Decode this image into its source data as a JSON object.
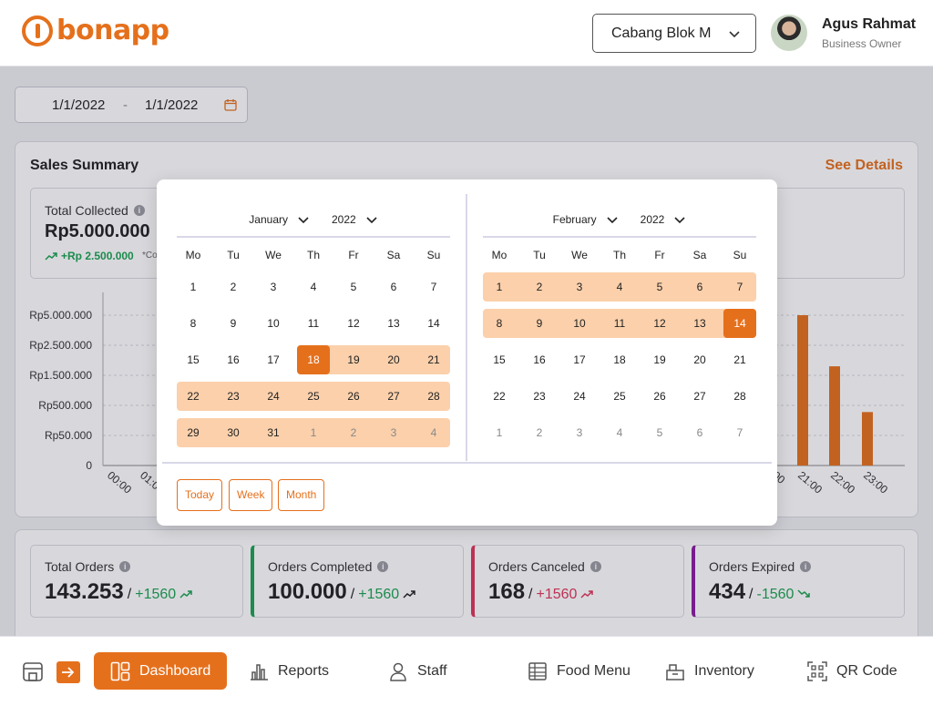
{
  "header": {
    "brand": "bonapp",
    "branch": "Cabang Blok M",
    "user_name": "Agus Rahmat",
    "user_role": "Business Owner"
  },
  "date_range": {
    "start": "1/1/2022",
    "separator": "-",
    "end": "1/1/2022"
  },
  "sales_summary": {
    "title": "Sales Summary",
    "see_details": "See Details",
    "collected_label": "Total Collected",
    "collected_value": "Rp5.000.000",
    "collected_delta": "+Rp 2.500.000",
    "collected_note": "*Co"
  },
  "chart_data": {
    "type": "bar",
    "ytick_labels": [
      "Rp5.000.000",
      "Rp2.500.000",
      "Rp1.500.000",
      "Rp500.000",
      "Rp50.000",
      "0"
    ],
    "xtick_labels_visible": [
      "00:00",
      "01:0",
      "",
      "00",
      "21:00",
      "22:00",
      "23:00"
    ],
    "categories": [
      "21:00",
      "22:00",
      "23:00"
    ],
    "values": [
      5000000,
      1800000,
      400000
    ],
    "grid": true,
    "color": "#e5701c"
  },
  "stats": [
    {
      "label": "Total Orders",
      "value": "143.253",
      "slash": "/",
      "delta": "+1560",
      "trend": "up",
      "accent": ""
    },
    {
      "label": "Orders Completed",
      "value": "100.000",
      "slash": "/",
      "delta": "+1560",
      "trend": "up-dark",
      "accent": "#1aa251"
    },
    {
      "label": "Orders Canceled",
      "value": "168",
      "slash": "/",
      "delta": "+1560",
      "trend": "up-red",
      "accent": "#e0345a"
    },
    {
      "label": "Orders Expired",
      "value": "434",
      "slash": "/",
      "delta": "-1560",
      "trend": "down-green",
      "accent": "#8a1aa0"
    }
  ],
  "nav": {
    "items": [
      {
        "label": "Dashboard",
        "icon": "dashboard-icon",
        "active": true
      },
      {
        "label": "Reports",
        "icon": "bar-chart-icon",
        "active": false
      },
      {
        "label": "Staff",
        "icon": "person-icon",
        "active": false
      },
      {
        "label": "Food Menu",
        "icon": "food-menu-icon",
        "active": false
      },
      {
        "label": "Inventory",
        "icon": "inventory-icon",
        "active": false
      },
      {
        "label": "QR Code",
        "icon": "qr-code-icon",
        "active": false
      }
    ]
  },
  "picker": {
    "weekdays": [
      "Mo",
      "Tu",
      "We",
      "Th",
      "Fr",
      "Sa",
      "Su"
    ],
    "left": {
      "month": "January",
      "year": "2022",
      "weeks": [
        [
          "1",
          "2",
          "3",
          "4",
          "5",
          "6",
          "7"
        ],
        [
          "8",
          "9",
          "10",
          "11",
          "12",
          "13",
          "14"
        ],
        [
          "15",
          "16",
          "17",
          "18",
          "19",
          "20",
          "21"
        ],
        [
          "22",
          "23",
          "24",
          "25",
          "26",
          "27",
          "28"
        ],
        [
          "29",
          "30",
          "31",
          "1",
          "2",
          "3",
          "4"
        ]
      ]
    },
    "right": {
      "month": "February",
      "year": "2022",
      "weeks": [
        [
          "1",
          "2",
          "3",
          "4",
          "5",
          "6",
          "7"
        ],
        [
          "8",
          "9",
          "10",
          "11",
          "12",
          "13",
          "14"
        ],
        [
          "15",
          "16",
          "17",
          "18",
          "19",
          "20",
          "21"
        ],
        [
          "22",
          "23",
          "24",
          "25",
          "26",
          "27",
          "28"
        ],
        [
          "1",
          "2",
          "3",
          "4",
          "5",
          "6",
          "7"
        ]
      ]
    },
    "range_start": "January 18",
    "range_end": "February 14",
    "quick": [
      "Today",
      "Week",
      "Month"
    ],
    "accent": "#e5701c",
    "range_fill": "#fbd0ab"
  }
}
